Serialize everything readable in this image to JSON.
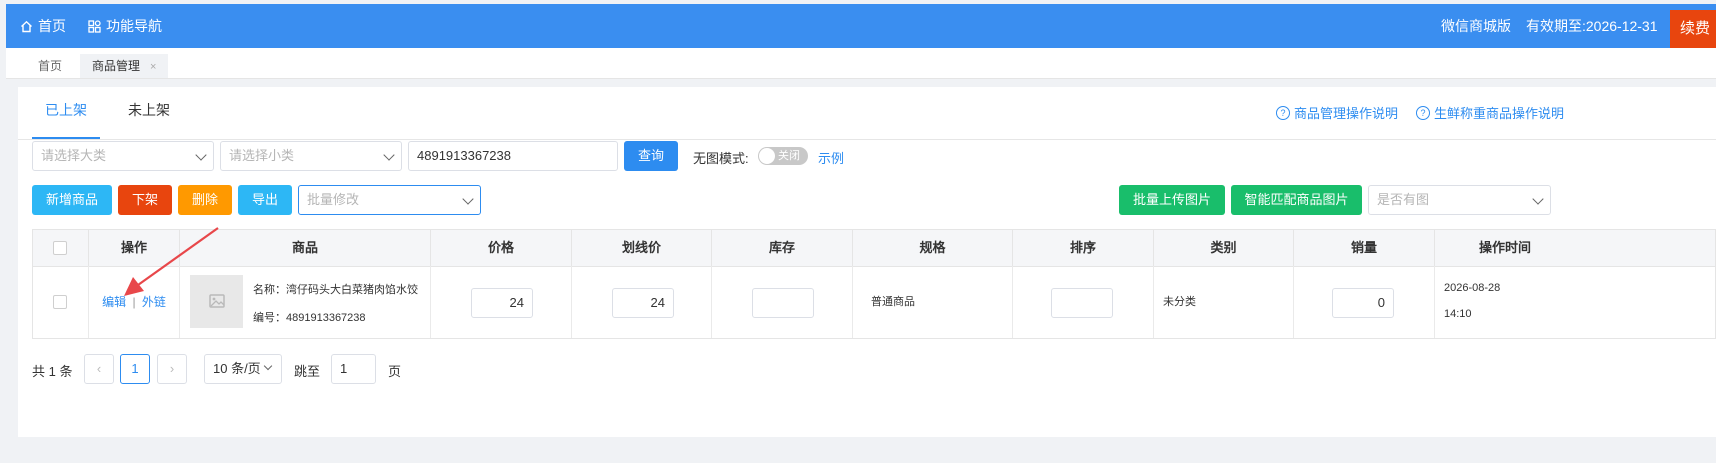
{
  "topbar": {
    "home_label": "首页",
    "nav_label": "功能导航",
    "edition": "微信商城版",
    "expire": "有效期至:2026-12-31",
    "renew_label": "续费",
    "bg_color": "#3a8ef0"
  },
  "page_tabs": [
    {
      "label": "首页",
      "active": false
    },
    {
      "label": "商品管理",
      "active": true
    }
  ],
  "subtabs": [
    {
      "label": "已上架",
      "active": true
    },
    {
      "label": "未上架",
      "active": false
    }
  ],
  "help_links": [
    "商品管理操作说明",
    "生鲜称重商品操作说明"
  ],
  "filters": {
    "category_placeholder": "请选择大类",
    "subcategory_placeholder": "请选择小类",
    "search_value": "4891913367238",
    "query_label": "查询",
    "no_image_mode_label": "无图模式:",
    "toggle_label": "关闭",
    "example_label": "示例"
  },
  "actions": {
    "add": "新增商品",
    "offline": "下架",
    "delete": "删除",
    "export": "导出",
    "batch_edit_placeholder": "批量修改",
    "batch_upload": "批量上传图片",
    "smart_match": "智能匹配商品图片",
    "has_image_placeholder": "是否有图"
  },
  "table": {
    "headers": [
      "操作",
      "商品",
      "价格",
      "划线价",
      "库存",
      "规格",
      "排序",
      "类别",
      "销量",
      "操作时间"
    ],
    "rows": [
      {
        "edit": "编辑",
        "sep": "|",
        "external": "外链",
        "name": "名称：湾仔码头大白菜猪肉馅水饺",
        "code": "编号：4891913367238",
        "price": "24",
        "strike_price": "24",
        "stock": "",
        "spec": "普通商品",
        "sort": "",
        "category": "未分类",
        "sales": "0",
        "date": "2026-08-28",
        "time": "14:10"
      }
    ]
  },
  "pagination": {
    "total": "共 1 条",
    "current_page": "1",
    "page_size": "10 条/页",
    "jump_label": "跳至",
    "jump_value": "1",
    "page_suffix": "页"
  },
  "colors": {
    "primary": "#2d8cf0",
    "cyan": "#2db7f5",
    "red": "#e8450e",
    "orange": "#ff9900",
    "green": "#19be6b",
    "arrow": "#e8474a"
  }
}
